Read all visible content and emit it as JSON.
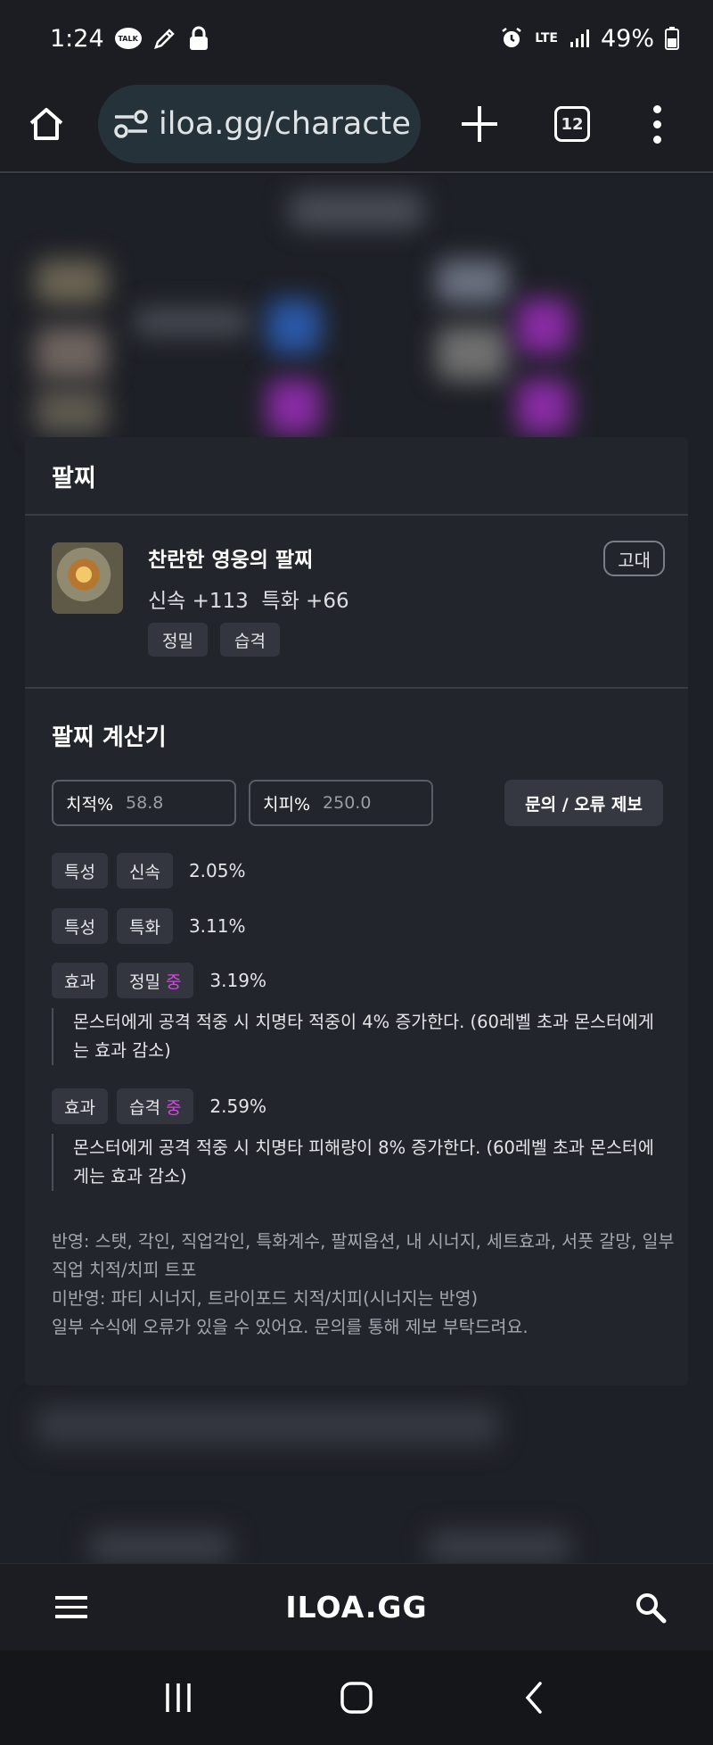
{
  "status_bar": {
    "time": "1:24",
    "talk_label": "TALK",
    "network": "LTE",
    "battery": "49%"
  },
  "browser": {
    "url": "iloa.gg/characte",
    "tab_count": "12"
  },
  "card": {
    "title": "팔찌",
    "item": {
      "name": "찬란한 영웅의 팔찌",
      "stats": "신속 +113  특화 +66",
      "tags": [
        "정밀",
        "습격"
      ],
      "grade": "고대"
    },
    "calculator": {
      "title": "팔찌 계산기",
      "crit_label": "치적%",
      "crit_value": "58.8",
      "critdmg_label": "치피%",
      "critdmg_value": "250.0",
      "report_button": "문의 / 오류 제보",
      "rows": [
        {
          "kind": "특성",
          "name": "신속",
          "grade": "",
          "pct": "2.05%"
        },
        {
          "kind": "특성",
          "name": "특화",
          "grade": "",
          "pct": "3.11%"
        },
        {
          "kind": "효과",
          "name": "정밀",
          "grade": "중",
          "pct": "3.19%"
        },
        {
          "kind": "효과",
          "name": "습격",
          "grade": "중",
          "pct": "2.59%"
        }
      ],
      "desc_precision": "몬스터에게 공격 적중 시 치명타 적중이 4% 증가한다. (60레벨 초과 몬스터에게는 효과 감소)",
      "desc_assault": "몬스터에게 공격 적중 시 치명타 피해량이 8% 증가한다. (60레벨 초과 몬스터에게는 효과 감소)",
      "footnote_1": "반영: 스탯, 각인, 직업각인, 특화계수, 팔찌옵션, 내 시너지, 세트효과, 서풋 갈망, 일부 직업 치적/치피 트포",
      "footnote_2": "미반영: 파티 시너지, 트라이포드 치적/치피(시너지는 반영)",
      "footnote_3": "일부 수식에 오류가 있을 수 있어요. 문의를 통해 제보 부탁드려요."
    }
  },
  "bottom_nav": {
    "logo": "ILOA.GG"
  }
}
